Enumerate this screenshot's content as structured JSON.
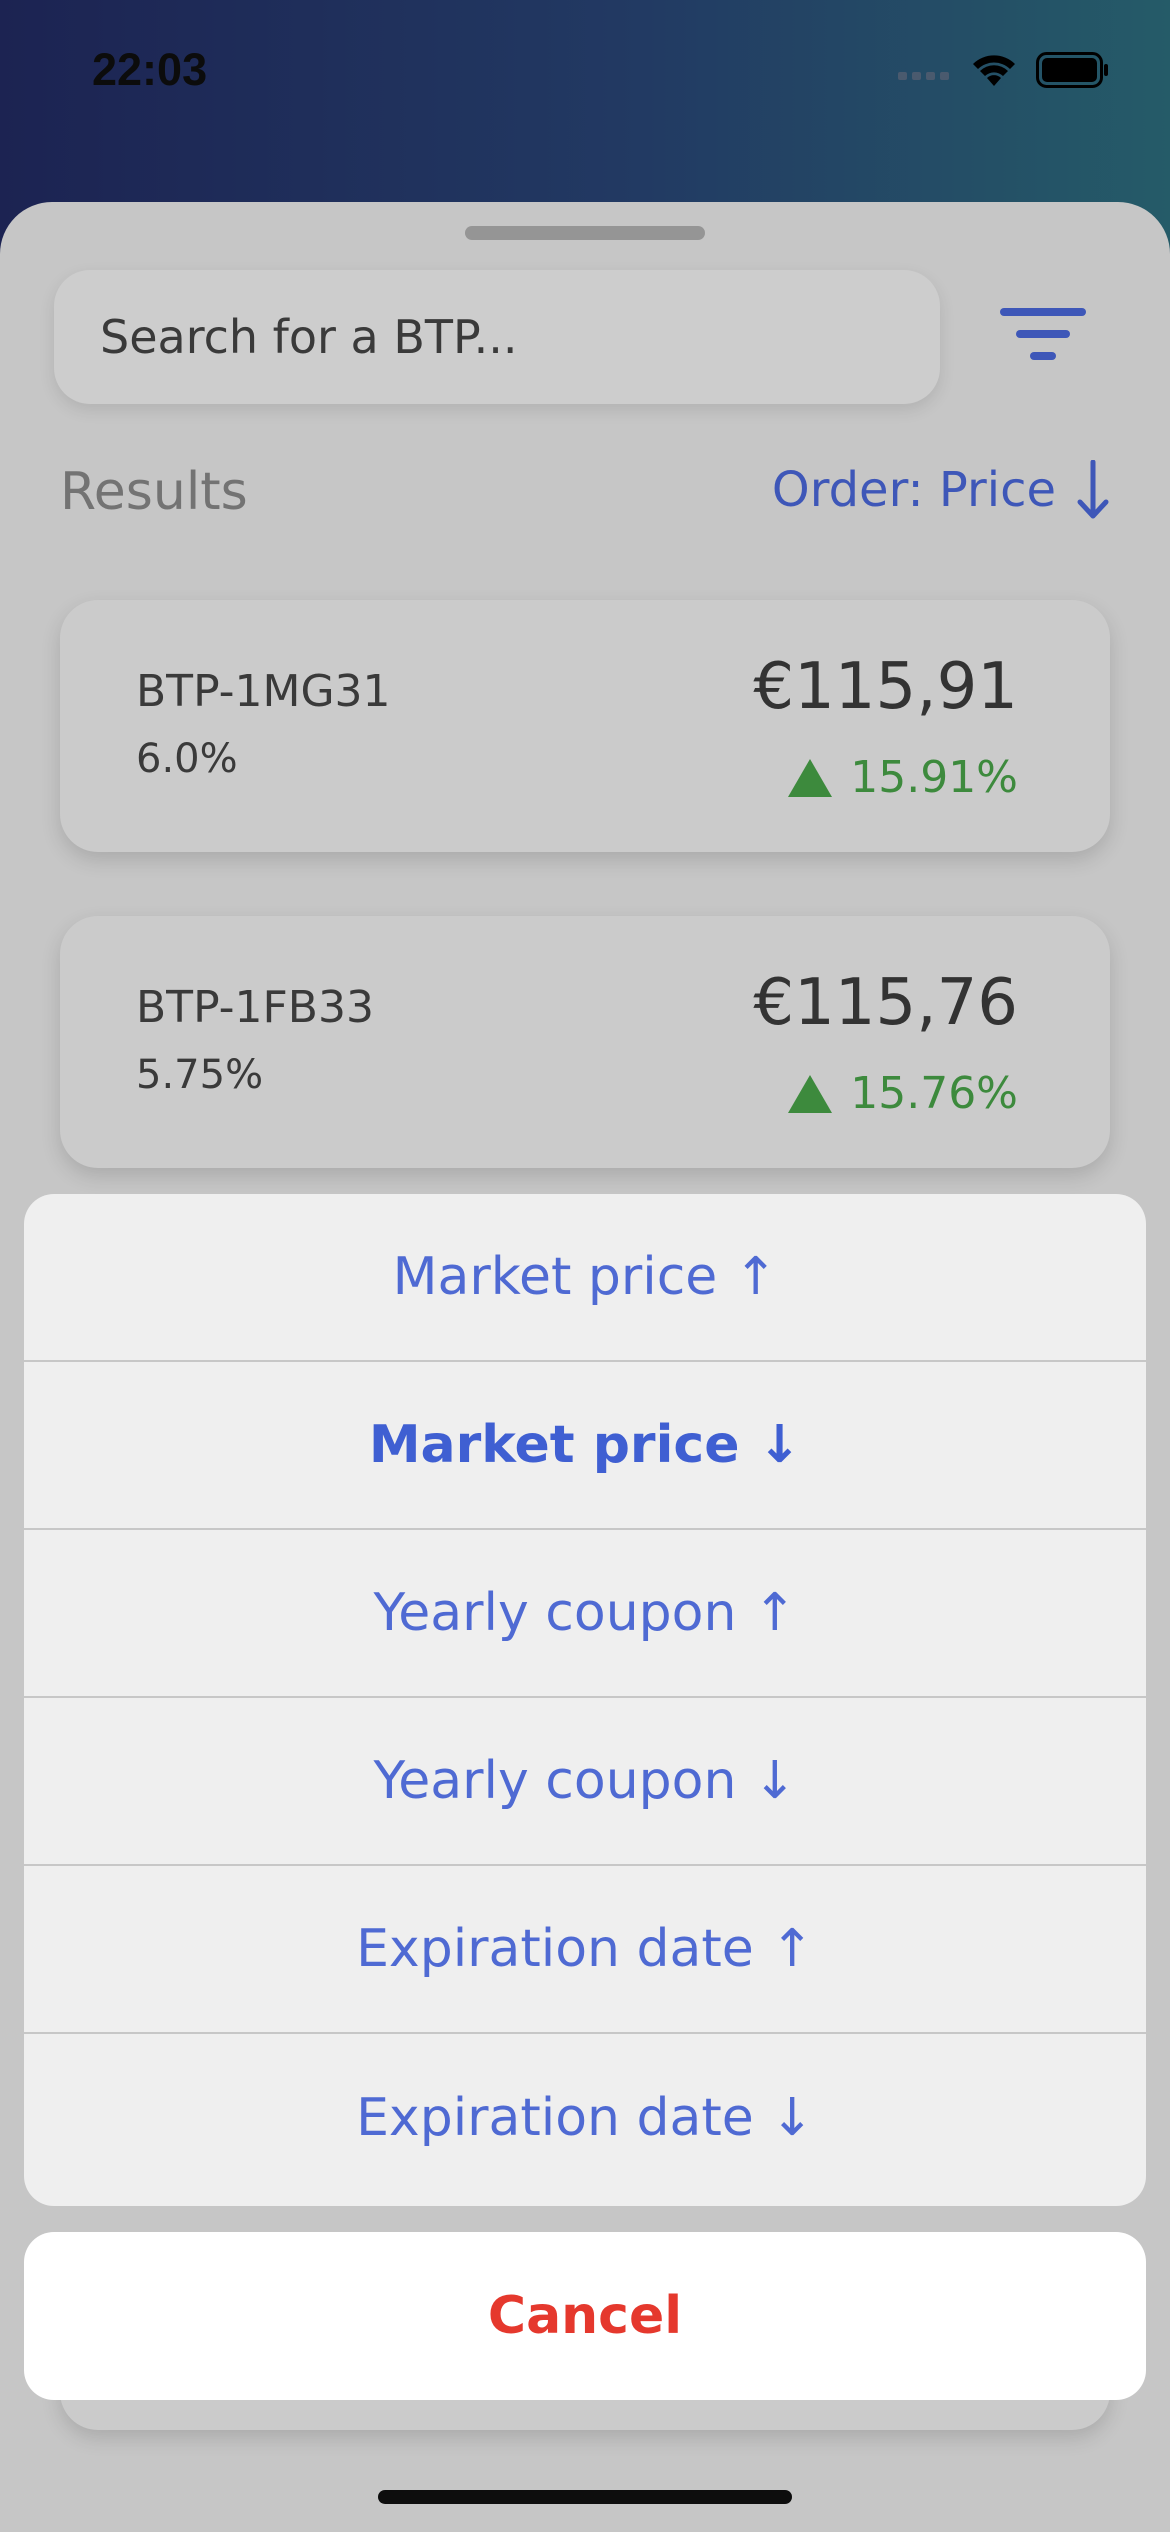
{
  "status_bar": {
    "time": "22:03"
  },
  "search": {
    "placeholder": "Search for a BTP..."
  },
  "results": {
    "label": "Results",
    "order_label": "Order: Price"
  },
  "bonds": [
    {
      "code": "BTP-1MG31",
      "coupon": "6.0%",
      "price": "€115,91",
      "change": "15.91%"
    },
    {
      "code": "BTP-1FB33",
      "coupon": "5.75%",
      "price": "€115,76",
      "change": "15.76%"
    }
  ],
  "sort_sheet": {
    "options": [
      "Market price ↑",
      "Market price ↓",
      "Yearly coupon ↑",
      "Yearly coupon ↓",
      "Expiration date ↑",
      "Expiration date ↓"
    ],
    "selected_index": 1,
    "cancel_label": "Cancel"
  },
  "colors": {
    "accent": "#3e57b8",
    "positive": "#3d8a3d",
    "destructive": "#e5382d"
  }
}
